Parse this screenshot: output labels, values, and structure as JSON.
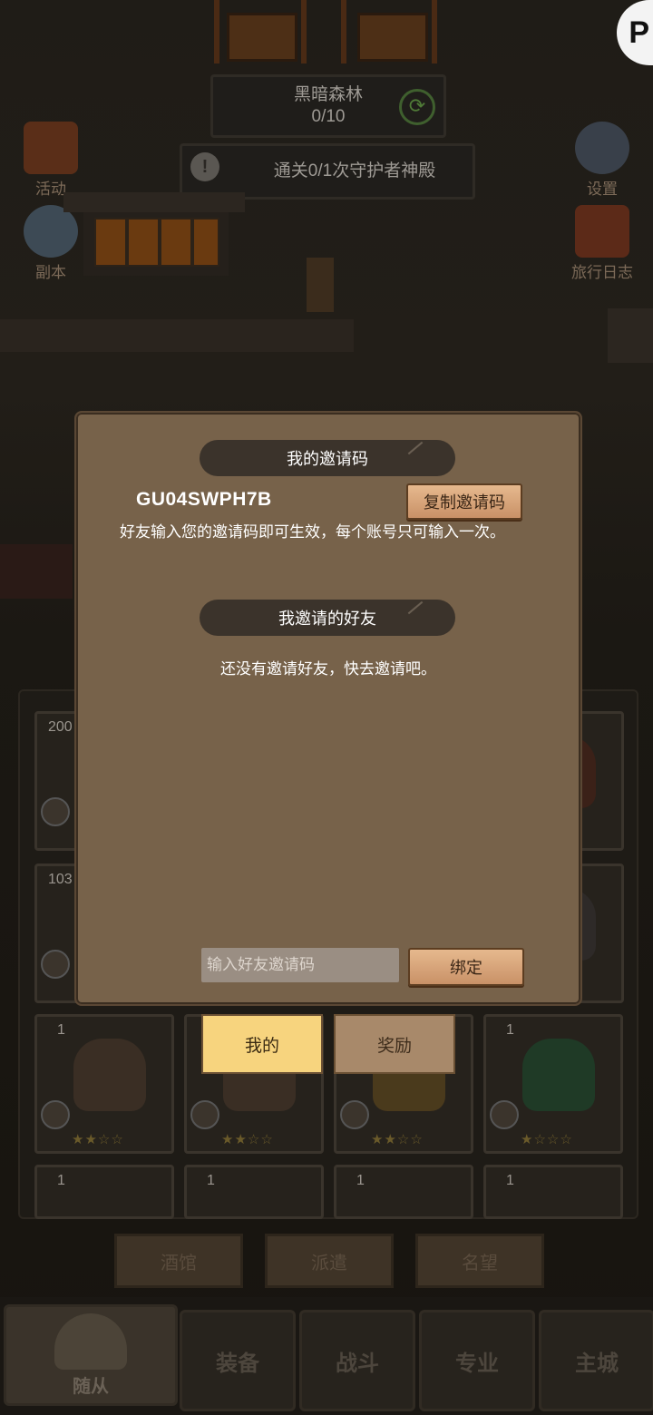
{
  "stage": {
    "name": "黑暗森林",
    "progress": "0/10"
  },
  "quest": {
    "text": "通关0/1次守护者神殿"
  },
  "side_menu": {
    "activity": "活动",
    "dungeon": "副本",
    "settings": "设置",
    "journal": "旅行日志"
  },
  "background_cards": {
    "counts": [
      "200",
      "103",
      "1",
      "1",
      "1",
      "1",
      "1",
      "1",
      "1",
      "1"
    ]
  },
  "sub_tabs": [
    "酒馆",
    "派遣",
    "名望"
  ],
  "bottom_nav": [
    "随从",
    "装备",
    "战斗",
    "专业",
    "主城"
  ],
  "modal": {
    "my_code_header": "我的邀请码",
    "invite_code": "GU04SWPH7B",
    "copy_button": "复制邀请码",
    "description": "好友输入您的邀请码即可生效，每个账号只可输入一次。",
    "friends_header": "我邀请的好友",
    "empty_text": "还没有邀请好友，快去邀请吧。",
    "input_placeholder": "输入好友邀请码",
    "bind_button": "绑定",
    "tabs": [
      {
        "label": "我的",
        "active": true
      },
      {
        "label": "奖励",
        "active": false
      }
    ]
  },
  "corner_badge": "P",
  "colors": {
    "modal_bg": "#77624a",
    "pill_bg": "#3b332b",
    "wood_button": "#d9a57a",
    "active_tab": "#f7d47e"
  }
}
